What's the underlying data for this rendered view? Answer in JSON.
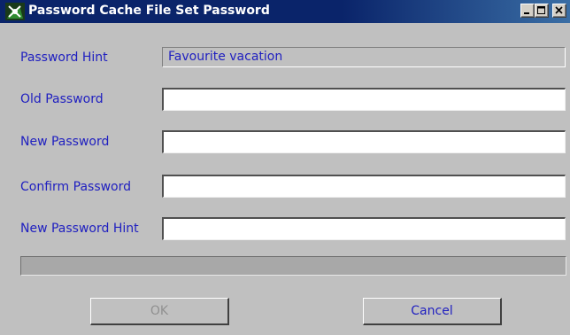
{
  "window": {
    "title": "Password Cache File Set Password",
    "controls": {
      "minimize_icon": "minimize-icon",
      "maximize_icon": "maximize-icon",
      "close_icon": "close-icon"
    }
  },
  "form": {
    "password_hint_label": "Password Hint",
    "password_hint_value": "Favourite vacation",
    "old_password_label": "Old Password",
    "old_password_value": "",
    "new_password_label": "New Password",
    "new_password_value": "",
    "confirm_password_label": "Confirm Password",
    "confirm_password_value": "",
    "new_password_hint_label": "New Password Hint",
    "new_password_hint_value": ""
  },
  "buttons": {
    "ok_label": "OK",
    "cancel_label": "Cancel"
  },
  "colors": {
    "titlebar": "#0a246a",
    "label_text": "#2020c0",
    "window_bg": "#c0c0c0",
    "disabled_text": "#909090"
  }
}
